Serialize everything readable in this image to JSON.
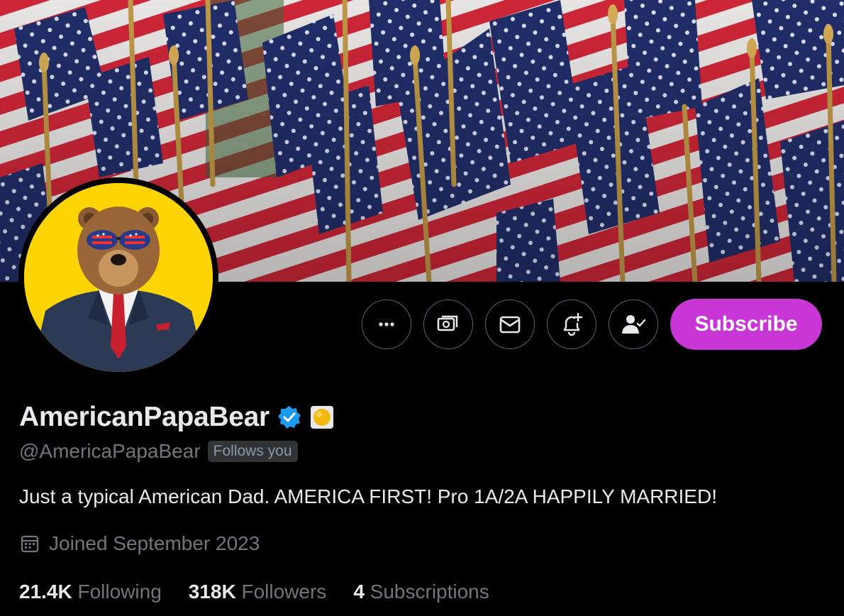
{
  "profile": {
    "display_name": "AmericanPapaBear",
    "handle": "@AmericaPapaBear",
    "follows_you": "Follows you",
    "bio": "Just a typical American Dad. AMERICA FIRST! Pro 1A/2A HAPPILY MARRIED!",
    "joined": "Joined September 2023"
  },
  "stats": {
    "following_count": "21.4K",
    "following_label": "Following",
    "followers_count": "318K",
    "followers_label": "Followers",
    "subscriptions_count": "4",
    "subscriptions_label": "Subscriptions"
  },
  "actions": {
    "more_icon": "ellipsis-icon",
    "tip_icon": "money-icon",
    "message_icon": "envelope-icon",
    "notify_icon": "bell-plus-icon",
    "following_icon": "person-check-icon",
    "subscribe_label": "Subscribe"
  },
  "colors": {
    "subscribe_bg": "#c936d6",
    "verified_badge": "#1d9bf0",
    "background": "#000000",
    "avatar_bg": "#ffd400"
  }
}
